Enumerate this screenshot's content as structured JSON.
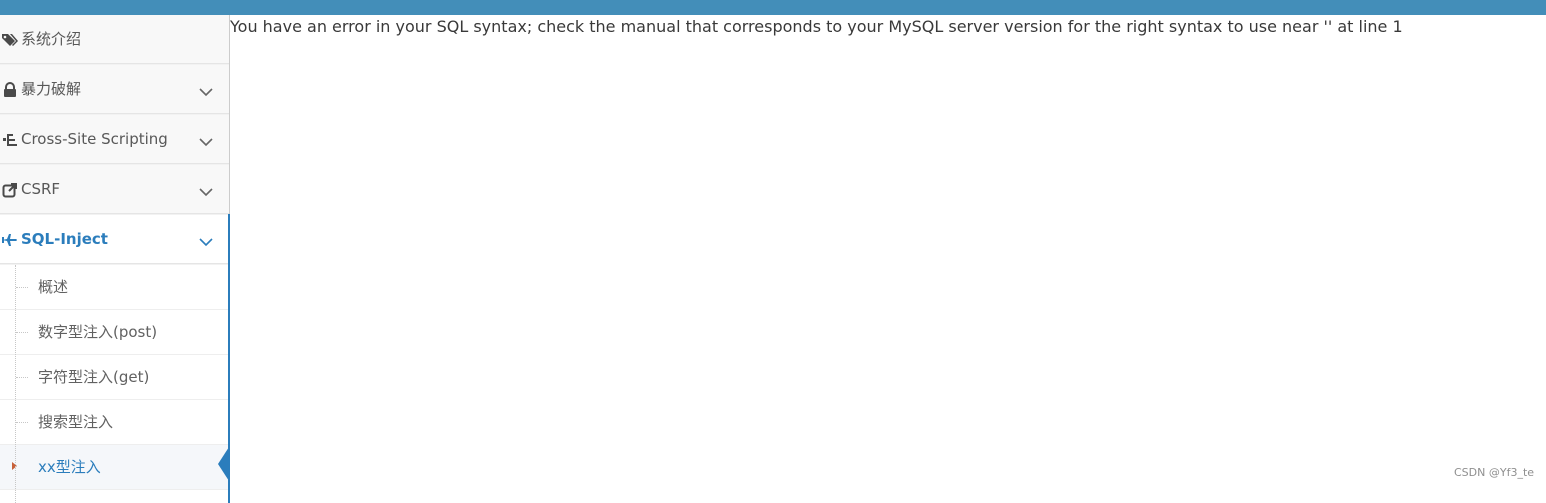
{
  "sidebar": {
    "items": [
      {
        "label": "系统介绍",
        "icon": "tags-icon"
      },
      {
        "label": "暴力破解",
        "icon": "lock-icon"
      },
      {
        "label": "Cross-Site Scripting",
        "icon": "tree-icon"
      },
      {
        "label": "CSRF",
        "icon": "external-link-icon"
      },
      {
        "label": "SQL-Inject",
        "icon": "plane-icon"
      }
    ],
    "sql_submenu": [
      {
        "label": "概述"
      },
      {
        "label": "数字型注入(post)"
      },
      {
        "label": "字符型注入(get)"
      },
      {
        "label": "搜索型注入"
      },
      {
        "label": "xx型注入"
      }
    ]
  },
  "main": {
    "message": "You have an error in your SQL syntax; check the manual that corresponds to your MySQL server version for the right syntax to use near '' at line 1"
  },
  "watermark": "CSDN @Yf3_te",
  "colors": {
    "topbar": "#438eb9",
    "accent": "#2b7dbc",
    "bullet": "#c86139"
  }
}
